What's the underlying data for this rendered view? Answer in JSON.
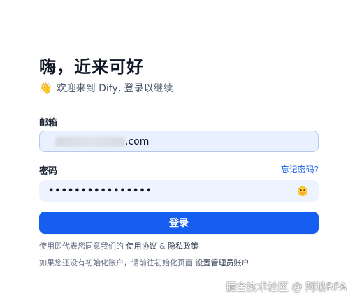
{
  "header": {
    "title": "嗨，近来可好",
    "wave_icon": "👋",
    "subtitle": "欢迎来到 Dify, 登录以继续"
  },
  "email": {
    "label": "邮箱",
    "value_suffix": ".com"
  },
  "password": {
    "label": "密码",
    "forgot_link": "忘记密码?",
    "masked_value": "••••••••••••••••"
  },
  "login_button": "登录",
  "terms": {
    "prefix": "使用即代表您同意我们的",
    "terms_link": "使用协议",
    "and": "&",
    "privacy_link": "隐私政策"
  },
  "setup": {
    "prefix": "如果您还没有初始化账户，请前往初始化页面",
    "link": "设置管理员账户"
  },
  "watermark": "掘金技术社区 @ 阿坡RPA",
  "colors": {
    "primary": "#155eef",
    "input_bg": "#eef4ff"
  }
}
